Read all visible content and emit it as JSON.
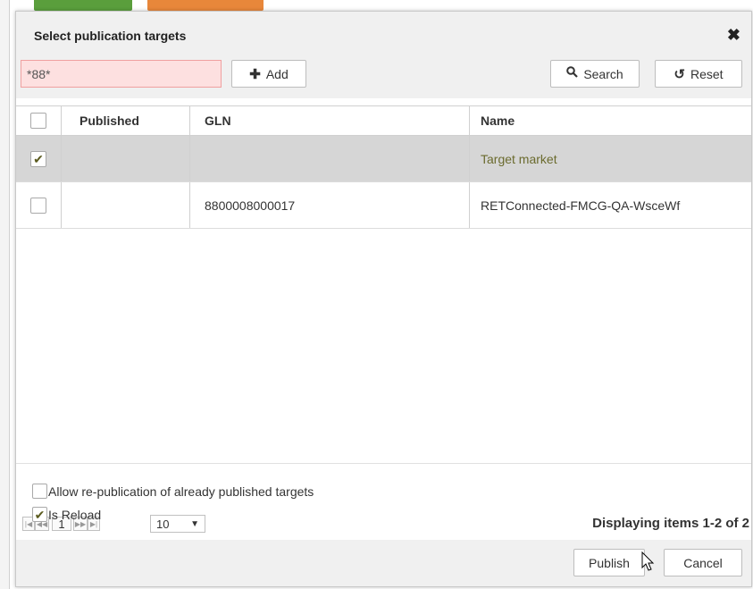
{
  "dialog": {
    "title": "Select publication targets",
    "close_glyph": "✖",
    "close_icon": "close-icon"
  },
  "toolbar": {
    "filter_value": "*88*",
    "add_label": "Add",
    "add_icon": "plus-icon",
    "search_label": "Search",
    "search_icon": "search-icon",
    "reset_label": "Reset",
    "reset_icon": "reset-icon"
  },
  "grid": {
    "columns": [
      "",
      "Published",
      "GLN",
      "Name"
    ],
    "rows": [
      {
        "checked": true,
        "published": "",
        "gln": "",
        "name": "Target market"
      },
      {
        "checked": false,
        "published": "",
        "gln": "8800008000017",
        "name": "RETConnected-FMCG-QA-WsceWf"
      }
    ]
  },
  "pager": {
    "page": "1",
    "page_size": "10",
    "info": "Displaying items 1-2 of 2"
  },
  "options": {
    "allow_republication_label": "Allow re-publication of already published targets",
    "allow_republication_checked": false,
    "is_reload_label": "Is Reload",
    "is_reload_checked": true
  },
  "footer": {
    "publish_label": "Publish",
    "cancel_label": "Cancel"
  },
  "colors": {
    "selected_row": "#d6d6d6",
    "filter_invalid_bg": "#fde0e0",
    "selected_text": "#6b6b2e"
  }
}
